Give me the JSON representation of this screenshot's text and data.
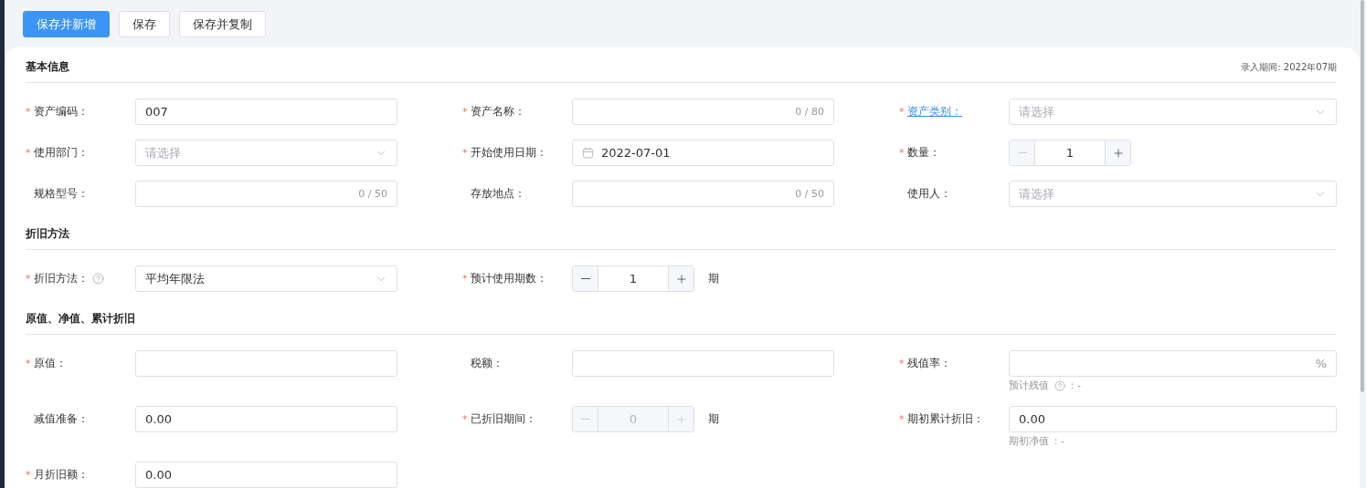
{
  "toolbar": {
    "buttons": [
      {
        "label": "保存并新增",
        "primary": true
      },
      {
        "label": "保存",
        "primary": false
      },
      {
        "label": "保存并复制",
        "primary": false
      }
    ]
  },
  "sections": [
    {
      "title": "基本信息",
      "period": "录入期间: 2022年07期",
      "fields": [
        {
          "label": "资产编码：",
          "required_mark": "*",
          "kind": "text",
          "value": "007"
        },
        {
          "label": "资产名称：",
          "required_mark": "*",
          "kind": "counter",
          "count": "0 / 80"
        },
        {
          "label": "资产类别：",
          "required_mark": "*",
          "link": true,
          "kind": "select",
          "placeholder": "请选择"
        },
        {
          "label": "使用部门：",
          "required_mark": "*",
          "kind": "select",
          "placeholder": "请选择"
        },
        {
          "label": "开始使用日期：",
          "required_mark": "*",
          "kind": "date",
          "value": "2022-07-01"
        },
        {
          "label": "数量：",
          "required_mark": "*",
          "kind": "stepper",
          "value": "1",
          "minus_disabled": true,
          "disabled": false
        },
        {
          "label": "规格型号：",
          "kind": "counter",
          "count": "0 / 50"
        },
        {
          "label": "存放地点：",
          "kind": "counter",
          "count": "0 / 50"
        },
        {
          "label": "使用人：",
          "kind": "select",
          "placeholder": "请选择"
        }
      ]
    },
    {
      "title": "折旧方法",
      "fields": [
        {
          "label": "折旧方法：",
          "required_mark": "*",
          "help": true,
          "kind": "select",
          "value": "平均年限法"
        },
        {
          "label": "预计使用期数：",
          "required_mark": "*",
          "kind": "stepper",
          "value": "1",
          "unit": "期",
          "minus_disabled": false,
          "disabled": false
        }
      ]
    },
    {
      "title": "原值、净值、累计折旧",
      "fields": [
        {
          "label": "原值：",
          "required_mark": "*",
          "kind": "text"
        },
        {
          "label": "税额：",
          "kind": "text"
        },
        {
          "label": "残值率：",
          "required_mark": "*",
          "kind": "percent",
          "suffix": "%",
          "note": {
            "label": "预计残值",
            "help": true,
            "value": "：-"
          }
        },
        {
          "label": "减值准备：",
          "kind": "text",
          "value": "0.00"
        },
        {
          "label": "已折旧期间：",
          "required_mark": "*",
          "kind": "stepper",
          "value": "0",
          "unit": "期",
          "minus_disabled": true,
          "disabled": true
        },
        {
          "label": "期初累计折旧：",
          "required_mark": "*",
          "kind": "text",
          "value": "0.00",
          "note": {
            "label": "期初净值",
            "value": "：-"
          }
        },
        {
          "label": "月折旧额：",
          "required_mark": "*",
          "kind": "text",
          "value": "0.00"
        }
      ]
    }
  ]
}
